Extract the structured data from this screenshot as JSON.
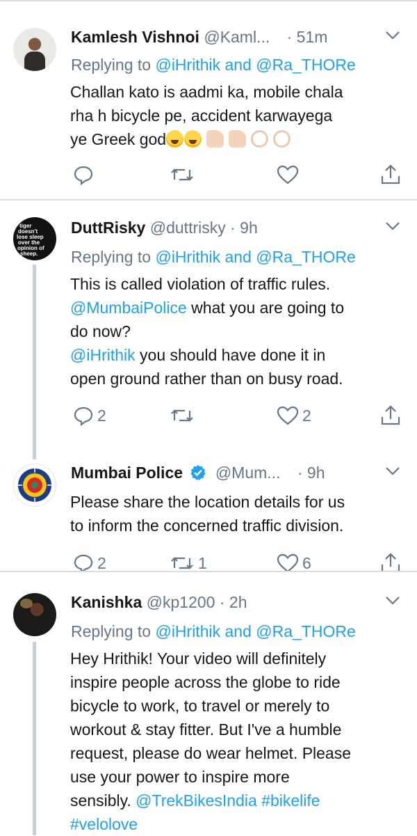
{
  "tweets": [
    {
      "name": "Kamlesh Vishnoi",
      "handle": "@Kaml...",
      "time": "· 51m",
      "replying_prefix": "Replying to",
      "replying_targets": "@iHrithik and @Ra_THORe",
      "lines": [
        "Challan kato is aadmi ka, mobile chala",
        "rha h bicycle pe, accident karwayega",
        "ye Greek god"
      ],
      "emojis": [
        "face-with-tears-of-joy",
        "face-with-tears-of-joy",
        "thumbs-up",
        "thumbs-up",
        "ok-hand",
        "ok-hand"
      ],
      "reply_count": "",
      "retweet_count": "",
      "like_count": ""
    },
    {
      "name": "DuttRisky",
      "handle": "@duttrisky",
      "time": "· 9h",
      "replying_prefix": "Replying to",
      "replying_targets": "@iHrithik and @Ra_THORe",
      "line1": "This is called violation of traffic rules.",
      "line2_link": "@MumbaiPolice",
      "line2_text": " what you are going to",
      "line3": "do now?",
      "line4_link": "@iHrithik",
      "line4_text": " you should have done it in",
      "line5": "open ground rather than on busy road.",
      "avatar_text": [
        "tiger",
        "doesn't",
        "lose sleep",
        "over the",
        "opinion of",
        "sheep."
      ],
      "reply_count": "2",
      "retweet_count": "",
      "like_count": "2"
    },
    {
      "name": "Mumbai Police",
      "handle": "@Mum...",
      "time": "· 9h",
      "lines": [
        "Please  share the location details for us",
        "to inform the concerned traffic division."
      ],
      "reply_count": "2",
      "retweet_count": "1",
      "like_count": "6"
    },
    {
      "name": "Kanishka",
      "handle": "@kp1200",
      "time": "· 2h",
      "replying_prefix": "Replying to",
      "replying_targets": "@iHrithik and @Ra_THORe",
      "lines": [
        "Hey Hrithik! Your video will definitely",
        "inspire people across the globe to ride",
        "bicycle to work, to travel or merely to",
        "workout & stay fitter. But I've a humble",
        "request, please do wear helmet. Please",
        "use your power to inspire more"
      ],
      "line7_text": "sensibly. ",
      "line7_link1": "@TrekBikesIndia",
      "line7_link2": " #bikelife",
      "line8_link": "#velolove"
    }
  ],
  "icons": {
    "reply": "reply-icon",
    "retweet": "retweet-icon",
    "like": "heart-icon",
    "share": "share-icon",
    "menu": "chevron-down-icon",
    "verified": "verified-badge-icon"
  },
  "colors": {
    "link": "#1da1f2",
    "secondary": "#657786",
    "verified": "#1da1f2"
  }
}
